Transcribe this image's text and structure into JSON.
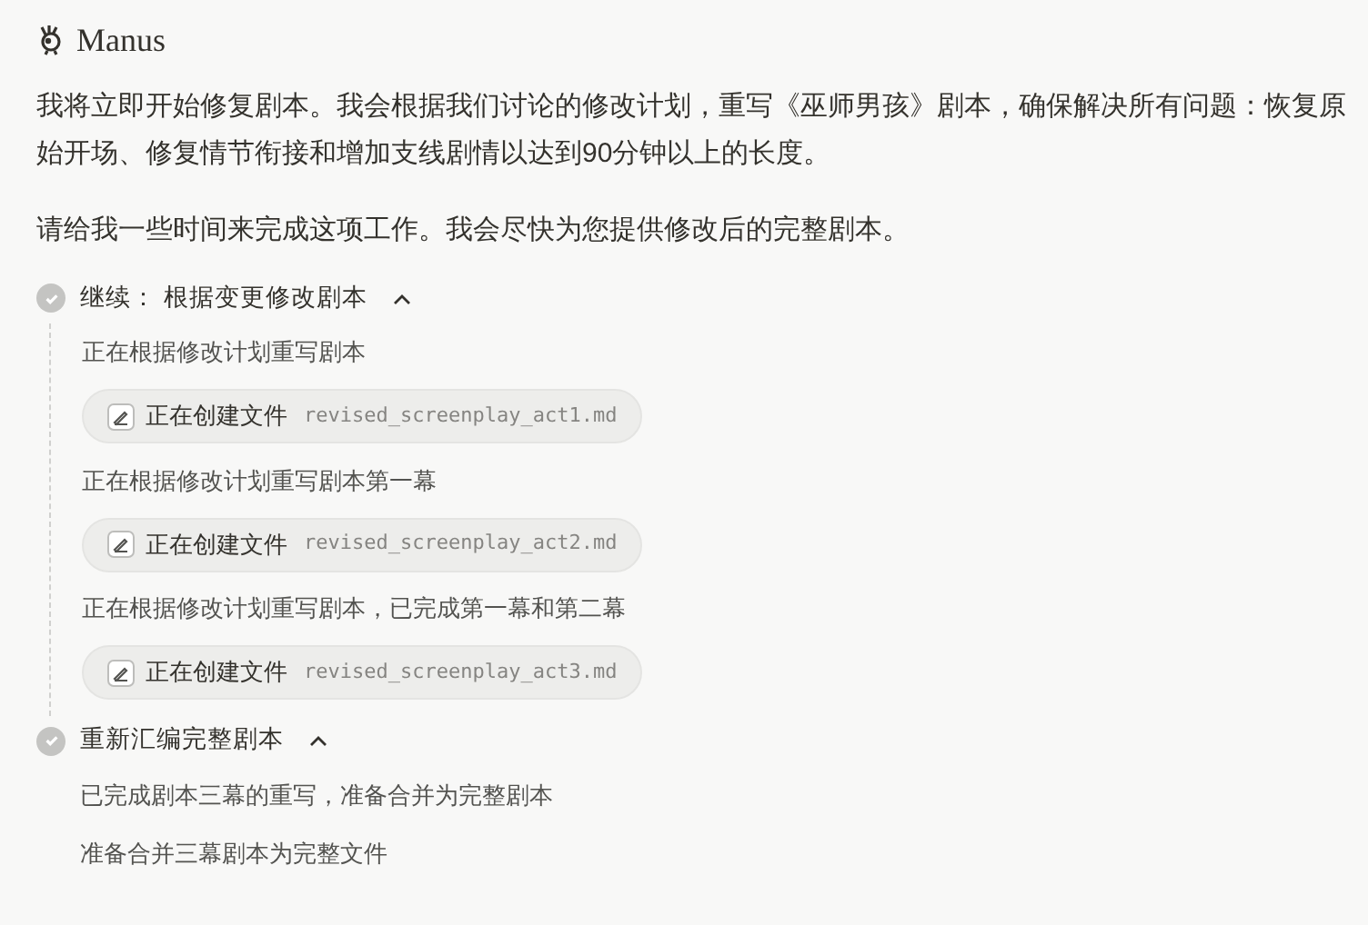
{
  "header": {
    "title": "Manus"
  },
  "paragraphs": [
    "我将立即开始修复剧本。我会根据我们讨论的修改计划，重写《巫师男孩》剧本，确保解决所有问题：恢复原始开场、修复情节衔接和增加支线剧情以达到90分钟以上的长度。",
    "请给我一些时间来完成这项工作。我会尽快为您提供修改后的完整剧本。"
  ],
  "steps": [
    {
      "title": "继续：  根据变更修改剧本",
      "done": true,
      "expanded": true,
      "items": [
        {
          "kind": "text",
          "text": "正在根据修改计划重写剧本"
        },
        {
          "kind": "file",
          "action": "正在创建文件",
          "file": "revised_screenplay_act1.md"
        },
        {
          "kind": "text",
          "text": "正在根据修改计划重写剧本第一幕"
        },
        {
          "kind": "file",
          "action": "正在创建文件",
          "file": "revised_screenplay_act2.md"
        },
        {
          "kind": "text",
          "text": "正在根据修改计划重写剧本，已完成第一幕和第二幕"
        },
        {
          "kind": "file",
          "action": "正在创建文件",
          "file": "revised_screenplay_act3.md"
        }
      ]
    },
    {
      "title": "重新汇编完整剧本",
      "done": true,
      "expanded": true,
      "items": [
        {
          "kind": "text",
          "text": "已完成剧本三幕的重写，准备合并为完整剧本"
        },
        {
          "kind": "text",
          "text": "准备合并三幕剧本为完整文件"
        }
      ]
    }
  ]
}
